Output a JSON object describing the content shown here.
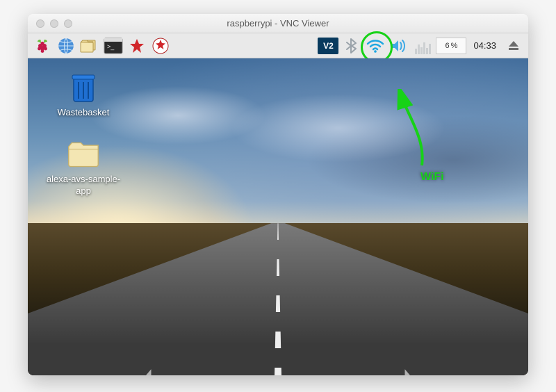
{
  "window": {
    "title": "raspberrypi - VNC Viewer"
  },
  "panel": {
    "vnc_label": "V2",
    "cpu_percent": "6",
    "cpu_unit": "%",
    "clock": "04:33",
    "icons": {
      "menu": "raspberry-icon",
      "browser": "globe-icon",
      "files": "files-icon",
      "terminal": "terminal-icon",
      "mathematica": "mathematica-icon",
      "wolfram": "wolfram-icon",
      "bluetooth": "bluetooth-icon",
      "wifi": "wifi-icon",
      "volume": "volume-icon",
      "eject": "eject-icon"
    }
  },
  "desktop": {
    "icons": [
      {
        "name": "wastebasket",
        "label": "Wastebasket"
      },
      {
        "name": "alexa-folder",
        "label": "alexa-avs-sample-app"
      }
    ]
  },
  "annotation": {
    "label": "WiFi"
  }
}
